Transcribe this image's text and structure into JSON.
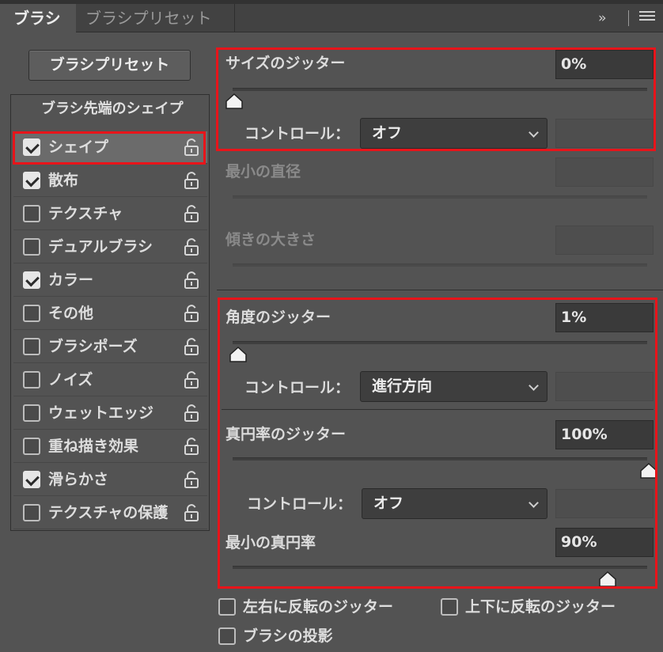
{
  "tabs": {
    "active": "ブラシ",
    "inactive": "ブラシプリセット",
    "overflow": "››"
  },
  "preset_button": "ブラシプリセット",
  "brush_tip_shape": "ブラシ先端のシェイプ",
  "options": [
    {
      "label": "シェイプ",
      "checked": true,
      "selected": true
    },
    {
      "label": "散布",
      "checked": true,
      "selected": false
    },
    {
      "label": "テクスチャ",
      "checked": false,
      "selected": false
    },
    {
      "label": "デュアルブラシ",
      "checked": false,
      "selected": false
    },
    {
      "label": "カラー",
      "checked": true,
      "selected": false
    },
    {
      "label": "その他",
      "checked": false,
      "selected": false
    },
    {
      "label": "ブラシポーズ",
      "checked": false,
      "selected": false
    },
    {
      "label": "ノイズ",
      "checked": false,
      "selected": false
    },
    {
      "label": "ウェットエッジ",
      "checked": false,
      "selected": false
    },
    {
      "label": "重ね描き効果",
      "checked": false,
      "selected": false
    },
    {
      "label": "滑らかさ",
      "checked": true,
      "selected": false
    },
    {
      "label": "テクスチャの保護",
      "checked": false,
      "selected": false
    }
  ],
  "size_jitter": {
    "label": "サイズのジッター",
    "value": "0%",
    "level": 0,
    "control_label": "コントロール：",
    "control_value": "オフ"
  },
  "min_diameter": {
    "label": "最小の直径"
  },
  "tilt_scale": {
    "label": "傾きの大きさ"
  },
  "angle_jitter": {
    "label": "角度のジッター",
    "value": "1%",
    "level": 0.01,
    "control_label": "コントロール：",
    "control_value": "進行方向"
  },
  "roundness_jitter": {
    "label": "真円率のジッター",
    "value": "100%",
    "level": 1.0,
    "control_label": "コントロール：",
    "control_value": "オフ"
  },
  "min_roundness": {
    "label": "最小の真円率",
    "value": "90%",
    "level": 0.9
  },
  "bottom_options": {
    "flip_x": "左右に反転のジッター",
    "flip_y": "上下に反転のジッター",
    "projection": "ブラシの投影"
  },
  "colors": {
    "panel": "#535353",
    "highlight": "#e8141a"
  }
}
